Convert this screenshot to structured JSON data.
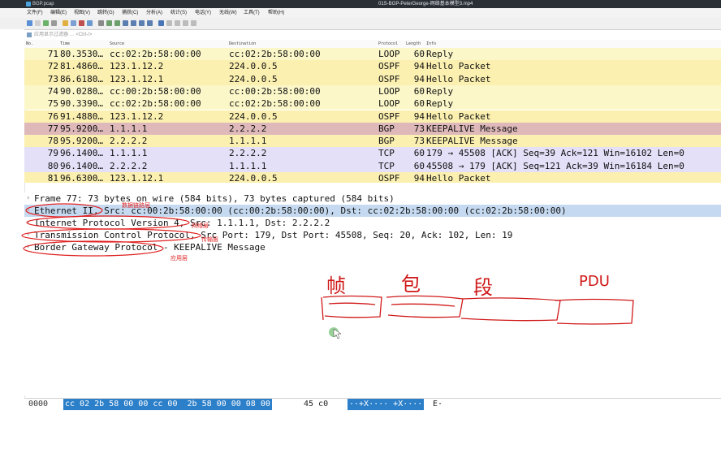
{
  "window": {
    "title": "BGP.pcap",
    "center_caption": "01S-BGP-PeterGeorge-网络基本模型3.mp4"
  },
  "menu": [
    "文件(F)",
    "编辑(E)",
    "视图(V)",
    "跳转(G)",
    "捕获(C)",
    "分析(A)",
    "统计(S)",
    "电话(Y)",
    "无线(W)",
    "工具(T)",
    "帮助(H)"
  ],
  "filter": {
    "placeholder": "应用显示过滤器 … <Ctrl-/>"
  },
  "columns": {
    "no": "No.",
    "time": "Time",
    "source": "Source",
    "destination": "Destination",
    "protocol": "Protocol",
    "length": "Length",
    "info": "Info"
  },
  "packets": [
    {
      "no": "71",
      "time": "80.3530…",
      "src": "cc:02:2b:58:00:00",
      "dst": "cc:02:2b:58:00:00",
      "proto": "LOOP",
      "len": "60",
      "info": "Reply",
      "color": "#fbf7c8"
    },
    {
      "no": "72",
      "time": "81.4860…",
      "src": "123.1.12.2",
      "dst": "224.0.0.5",
      "proto": "OSPF",
      "len": "94",
      "info": "Hello Packet",
      "color": "#fbf0b0"
    },
    {
      "no": "73",
      "time": "86.6180…",
      "src": "123.1.12.1",
      "dst": "224.0.0.5",
      "proto": "OSPF",
      "len": "94",
      "info": "Hello Packet",
      "color": "#fbf0b0"
    },
    {
      "no": "74",
      "time": "90.0280…",
      "src": "cc:00:2b:58:00:00",
      "dst": "cc:00:2b:58:00:00",
      "proto": "LOOP",
      "len": "60",
      "info": "Reply",
      "color": "#fbf7c8"
    },
    {
      "no": "75",
      "time": "90.3390…",
      "src": "cc:02:2b:58:00:00",
      "dst": "cc:02:2b:58:00:00",
      "proto": "LOOP",
      "len": "60",
      "info": "Reply",
      "color": "#fbf7c8"
    },
    {
      "no": "76",
      "time": "91.4880…",
      "src": "123.1.12.2",
      "dst": "224.0.0.5",
      "proto": "OSPF",
      "len": "94",
      "info": "Hello Packet",
      "color": "#fbf0b0"
    },
    {
      "no": "77",
      "time": "95.9200…",
      "src": "1.1.1.1",
      "dst": "2.2.2.2",
      "proto": "BGP",
      "len": "73",
      "info": "KEEPALIVE Message",
      "color": "#dfb9b9"
    },
    {
      "no": "78",
      "time": "95.9200…",
      "src": "2.2.2.2",
      "dst": "1.1.1.1",
      "proto": "BGP",
      "len": "73",
      "info": "KEEPALIVE Message",
      "color": "#fbf0b0"
    },
    {
      "no": "79",
      "time": "96.1400…",
      "src": "1.1.1.1",
      "dst": "2.2.2.2",
      "proto": "TCP",
      "len": "60",
      "info": "179 → 45508 [ACK] Seq=39 Ack=121 Win=16102 Len=0",
      "color": "#e4e0f8"
    },
    {
      "no": "80",
      "time": "96.1400…",
      "src": "2.2.2.2",
      "dst": "1.1.1.1",
      "proto": "TCP",
      "len": "60",
      "info": "45508 → 179 [ACK] Seq=121 Ack=39 Win=16184 Len=0",
      "color": "#e4e0f8"
    },
    {
      "no": "81",
      "time": "96.6300…",
      "src": "123.1.12.1",
      "dst": "224.0.0.5",
      "proto": "OSPF",
      "len": "94",
      "info": "Hello Packet",
      "color": "#fbf0b0"
    }
  ],
  "details": {
    "frame": "Frame 77: 73 bytes on wire (584 bits), 73 bytes captured (584 bits)",
    "ethernet": "Ethernet II, Src: cc:00:2b:58:00:00 (cc:00:2b:58:00:00), Dst: cc:02:2b:58:00:00 (cc:02:2b:58:00:00)",
    "ip": "Internet Protocol Version 4, Src: 1.1.1.1, Dst: 2.2.2.2",
    "tcp": "Transmission Control Protocol, Src Port: 179, Dst Port: 45508, Seq: 20, Ack: 102, Len: 19",
    "bgp": "Border Gateway Protocol - KEEPALIVE Message"
  },
  "bytes": {
    "offset": "0000",
    "hex_selected": "cc 02 2b 58 00 00 cc 00  2b 58 00 00 08 00",
    "hex_rest": "45 c0",
    "ascii_selected": "··+X···· +X····",
    "ascii_rest": "E·"
  },
  "annotations": {
    "eth_layer": "数据链路层",
    "ip_layer": "网络层",
    "tcp_layer": "传输层",
    "app_layer": "应用层",
    "handwriting": [
      "帧",
      "包",
      "段",
      "PDU"
    ]
  }
}
